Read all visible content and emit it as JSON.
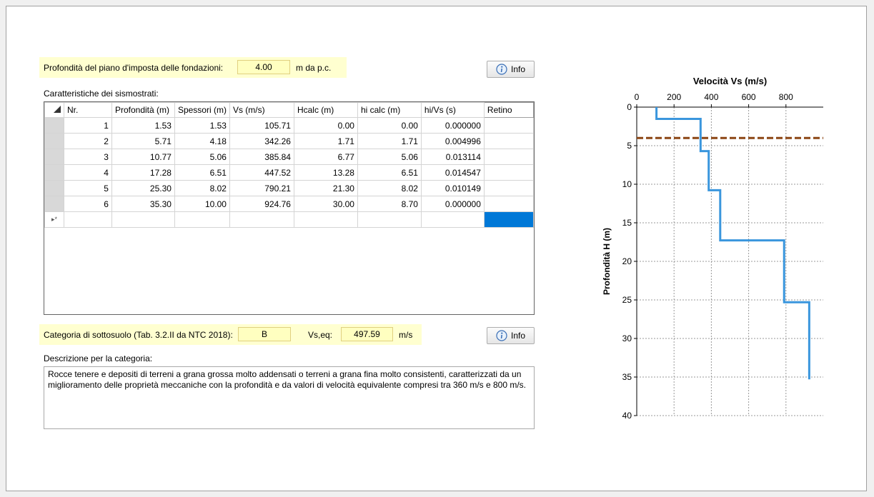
{
  "foundation": {
    "label": "Profondità del piano d'imposta delle fondazioni:",
    "value": "4.00",
    "unit": "m da p.c."
  },
  "info_button": {
    "label": "Info",
    "icon": "info-icon"
  },
  "table_title": "Caratteristiche dei sismostrati:",
  "table": {
    "columns": [
      "Nr.",
      "Profondità (m)",
      "Spessori (m)",
      "Vs (m/s)",
      "Hcalc (m)",
      "hi calc (m)",
      "hi/Vs (s)",
      "Retino"
    ],
    "rows": [
      [
        "1",
        "1.53",
        "1.53",
        "105.71",
        "0.00",
        "0.00",
        "0.000000",
        ""
      ],
      [
        "2",
        "5.71",
        "4.18",
        "342.26",
        "1.71",
        "1.71",
        "0.004996",
        ""
      ],
      [
        "3",
        "10.77",
        "5.06",
        "385.84",
        "6.77",
        "5.06",
        "0.013114",
        ""
      ],
      [
        "4",
        "17.28",
        "6.51",
        "447.52",
        "13.28",
        "6.51",
        "0.014547",
        ""
      ],
      [
        "5",
        "25.30",
        "8.02",
        "790.21",
        "21.30",
        "8.02",
        "0.010149",
        ""
      ],
      [
        "6",
        "35.30",
        "10.00",
        "924.76",
        "30.00",
        "8.70",
        "0.000000",
        ""
      ]
    ],
    "new_row_marker": "▸*"
  },
  "category": {
    "label": "Categoria di sottosuolo (Tab. 3.2.II da NTC 2018):",
    "value": "B",
    "vseq_label": "Vs,eq:",
    "vseq_value": "497.59",
    "vseq_unit": "m/s"
  },
  "description": {
    "label": "Descrizione per la categoria:",
    "text": "Rocce tenere e depositi di terreni a grana grossa molto addensati o terreni a grana fina molto consistenti, caratterizzati da un miglioramento delle proprietà meccaniche con la profondità e da valori di velocità equivalente compresi tra 360 m/s e 800 m/s."
  },
  "chart_data": {
    "type": "line",
    "title": "Velocità Vs (m/s)",
    "xlabel": "",
    "ylabel": "Profondità H (m)",
    "xlim": [
      0,
      1000
    ],
    "ylim": [
      40,
      0
    ],
    "x_ticks": [
      0,
      200,
      400,
      600,
      800
    ],
    "y_ticks": [
      0,
      5,
      10,
      15,
      20,
      25,
      30,
      35,
      40
    ],
    "x_axis_position": "top",
    "grid": true,
    "series": [
      {
        "x": [
          105.71,
          105.71,
          342.26,
          342.26,
          385.84,
          385.84,
          447.52,
          447.52,
          790.21,
          790.21,
          924.76,
          924.76
        ],
        "y": [
          0,
          1.53,
          1.53,
          5.71,
          5.71,
          10.77,
          10.77,
          17.28,
          17.28,
          25.3,
          25.3,
          35.3
        ],
        "color": "#3a96dd"
      }
    ],
    "foundation_line": {
      "y": 4.0,
      "color": "#8b4513",
      "style": "dashed"
    }
  }
}
